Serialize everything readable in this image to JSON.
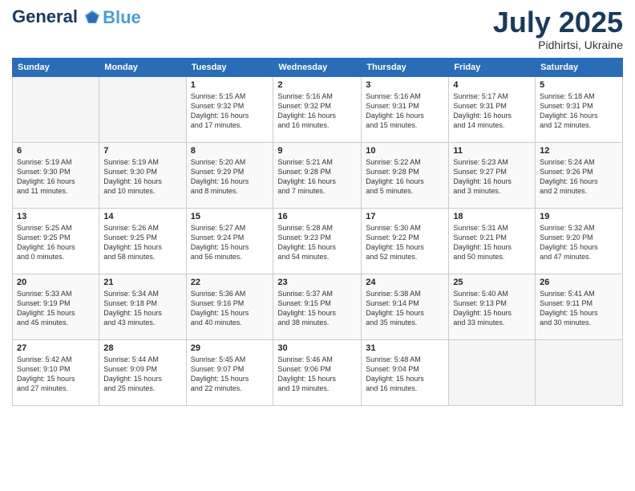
{
  "header": {
    "logo_general": "General",
    "logo_blue": "Blue",
    "month_year": "July 2025",
    "location": "Pidhirtsi, Ukraine"
  },
  "days_of_week": [
    "Sunday",
    "Monday",
    "Tuesday",
    "Wednesday",
    "Thursday",
    "Friday",
    "Saturday"
  ],
  "weeks": [
    [
      {
        "day": "",
        "empty": true
      },
      {
        "day": "",
        "empty": true
      },
      {
        "day": "1",
        "sunrise": "Sunrise: 5:15 AM",
        "sunset": "Sunset: 9:32 PM",
        "daylight": "Daylight: 16 hours and 17 minutes."
      },
      {
        "day": "2",
        "sunrise": "Sunrise: 5:16 AM",
        "sunset": "Sunset: 9:32 PM",
        "daylight": "Daylight: 16 hours and 16 minutes."
      },
      {
        "day": "3",
        "sunrise": "Sunrise: 5:16 AM",
        "sunset": "Sunset: 9:31 PM",
        "daylight": "Daylight: 16 hours and 15 minutes."
      },
      {
        "day": "4",
        "sunrise": "Sunrise: 5:17 AM",
        "sunset": "Sunset: 9:31 PM",
        "daylight": "Daylight: 16 hours and 14 minutes."
      },
      {
        "day": "5",
        "sunrise": "Sunrise: 5:18 AM",
        "sunset": "Sunset: 9:31 PM",
        "daylight": "Daylight: 16 hours and 12 minutes."
      }
    ],
    [
      {
        "day": "6",
        "sunrise": "Sunrise: 5:19 AM",
        "sunset": "Sunset: 9:30 PM",
        "daylight": "Daylight: 16 hours and 11 minutes."
      },
      {
        "day": "7",
        "sunrise": "Sunrise: 5:19 AM",
        "sunset": "Sunset: 9:30 PM",
        "daylight": "Daylight: 16 hours and 10 minutes."
      },
      {
        "day": "8",
        "sunrise": "Sunrise: 5:20 AM",
        "sunset": "Sunset: 9:29 PM",
        "daylight": "Daylight: 16 hours and 8 minutes."
      },
      {
        "day": "9",
        "sunrise": "Sunrise: 5:21 AM",
        "sunset": "Sunset: 9:28 PM",
        "daylight": "Daylight: 16 hours and 7 minutes."
      },
      {
        "day": "10",
        "sunrise": "Sunrise: 5:22 AM",
        "sunset": "Sunset: 9:28 PM",
        "daylight": "Daylight: 16 hours and 5 minutes."
      },
      {
        "day": "11",
        "sunrise": "Sunrise: 5:23 AM",
        "sunset": "Sunset: 9:27 PM",
        "daylight": "Daylight: 16 hours and 3 minutes."
      },
      {
        "day": "12",
        "sunrise": "Sunrise: 5:24 AM",
        "sunset": "Sunset: 9:26 PM",
        "daylight": "Daylight: 16 hours and 2 minutes."
      }
    ],
    [
      {
        "day": "13",
        "sunrise": "Sunrise: 5:25 AM",
        "sunset": "Sunset: 9:25 PM",
        "daylight": "Daylight: 16 hours and 0 minutes."
      },
      {
        "day": "14",
        "sunrise": "Sunrise: 5:26 AM",
        "sunset": "Sunset: 9:25 PM",
        "daylight": "Daylight: 15 hours and 58 minutes."
      },
      {
        "day": "15",
        "sunrise": "Sunrise: 5:27 AM",
        "sunset": "Sunset: 9:24 PM",
        "daylight": "Daylight: 15 hours and 56 minutes."
      },
      {
        "day": "16",
        "sunrise": "Sunrise: 5:28 AM",
        "sunset": "Sunset: 9:23 PM",
        "daylight": "Daylight: 15 hours and 54 minutes."
      },
      {
        "day": "17",
        "sunrise": "Sunrise: 5:30 AM",
        "sunset": "Sunset: 9:22 PM",
        "daylight": "Daylight: 15 hours and 52 minutes."
      },
      {
        "day": "18",
        "sunrise": "Sunrise: 5:31 AM",
        "sunset": "Sunset: 9:21 PM",
        "daylight": "Daylight: 15 hours and 50 minutes."
      },
      {
        "day": "19",
        "sunrise": "Sunrise: 5:32 AM",
        "sunset": "Sunset: 9:20 PM",
        "daylight": "Daylight: 15 hours and 47 minutes."
      }
    ],
    [
      {
        "day": "20",
        "sunrise": "Sunrise: 5:33 AM",
        "sunset": "Sunset: 9:19 PM",
        "daylight": "Daylight: 15 hours and 45 minutes."
      },
      {
        "day": "21",
        "sunrise": "Sunrise: 5:34 AM",
        "sunset": "Sunset: 9:18 PM",
        "daylight": "Daylight: 15 hours and 43 minutes."
      },
      {
        "day": "22",
        "sunrise": "Sunrise: 5:36 AM",
        "sunset": "Sunset: 9:16 PM",
        "daylight": "Daylight: 15 hours and 40 minutes."
      },
      {
        "day": "23",
        "sunrise": "Sunrise: 5:37 AM",
        "sunset": "Sunset: 9:15 PM",
        "daylight": "Daylight: 15 hours and 38 minutes."
      },
      {
        "day": "24",
        "sunrise": "Sunrise: 5:38 AM",
        "sunset": "Sunset: 9:14 PM",
        "daylight": "Daylight: 15 hours and 35 minutes."
      },
      {
        "day": "25",
        "sunrise": "Sunrise: 5:40 AM",
        "sunset": "Sunset: 9:13 PM",
        "daylight": "Daylight: 15 hours and 33 minutes."
      },
      {
        "day": "26",
        "sunrise": "Sunrise: 5:41 AM",
        "sunset": "Sunset: 9:11 PM",
        "daylight": "Daylight: 15 hours and 30 minutes."
      }
    ],
    [
      {
        "day": "27",
        "sunrise": "Sunrise: 5:42 AM",
        "sunset": "Sunset: 9:10 PM",
        "daylight": "Daylight: 15 hours and 27 minutes."
      },
      {
        "day": "28",
        "sunrise": "Sunrise: 5:44 AM",
        "sunset": "Sunset: 9:09 PM",
        "daylight": "Daylight: 15 hours and 25 minutes."
      },
      {
        "day": "29",
        "sunrise": "Sunrise: 5:45 AM",
        "sunset": "Sunset: 9:07 PM",
        "daylight": "Daylight: 15 hours and 22 minutes."
      },
      {
        "day": "30",
        "sunrise": "Sunrise: 5:46 AM",
        "sunset": "Sunset: 9:06 PM",
        "daylight": "Daylight: 15 hours and 19 minutes."
      },
      {
        "day": "31",
        "sunrise": "Sunrise: 5:48 AM",
        "sunset": "Sunset: 9:04 PM",
        "daylight": "Daylight: 15 hours and 16 minutes."
      },
      {
        "day": "",
        "empty": true
      },
      {
        "day": "",
        "empty": true
      }
    ]
  ]
}
